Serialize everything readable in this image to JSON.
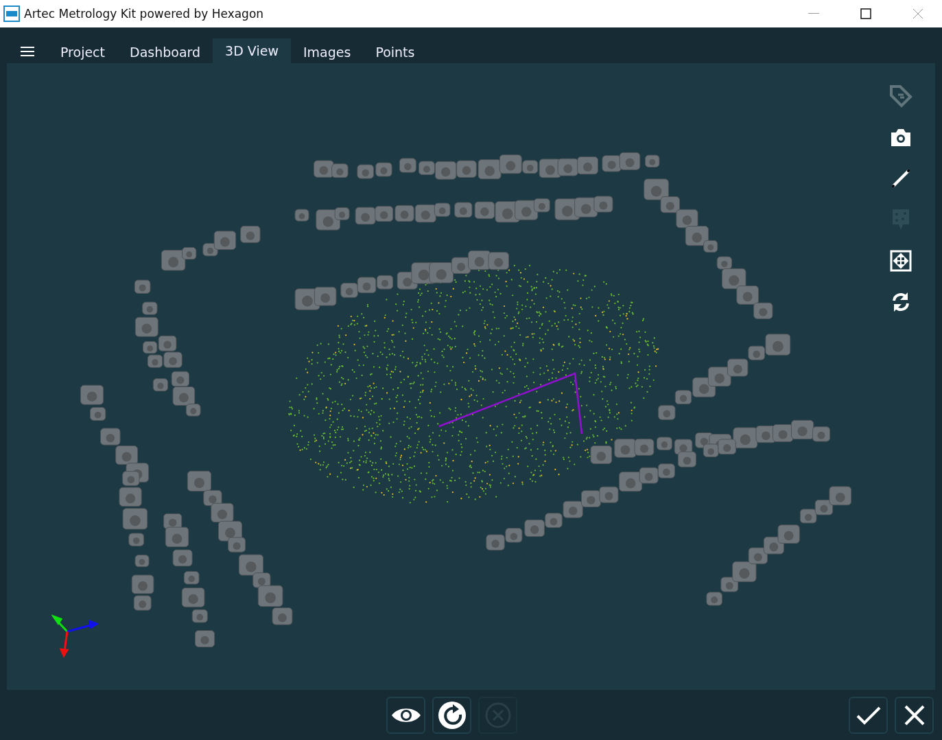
{
  "window": {
    "title": "Artec Metrology Kit powered by Hexagon"
  },
  "tabs": [
    {
      "label": "Project",
      "selected": false
    },
    {
      "label": "Dashboard",
      "selected": false
    },
    {
      "label": "3D View",
      "selected": true
    },
    {
      "label": "Images",
      "selected": false
    },
    {
      "label": "Points",
      "selected": false
    }
  ],
  "tools": [
    {
      "kind": "tag",
      "disabled": true
    },
    {
      "kind": "camera",
      "disabled": false
    },
    {
      "kind": "ruler",
      "disabled": false
    },
    {
      "kind": "markers",
      "disabled": true
    },
    {
      "kind": "fit",
      "disabled": false
    },
    {
      "kind": "rotate",
      "disabled": false
    }
  ],
  "actions": [
    {
      "kind": "eye",
      "disabled": false
    },
    {
      "kind": "refresh",
      "disabled": false
    },
    {
      "kind": "cancel",
      "disabled": true
    }
  ],
  "dialog_buttons": [
    {
      "kind": "ok"
    },
    {
      "kind": "close"
    }
  ]
}
